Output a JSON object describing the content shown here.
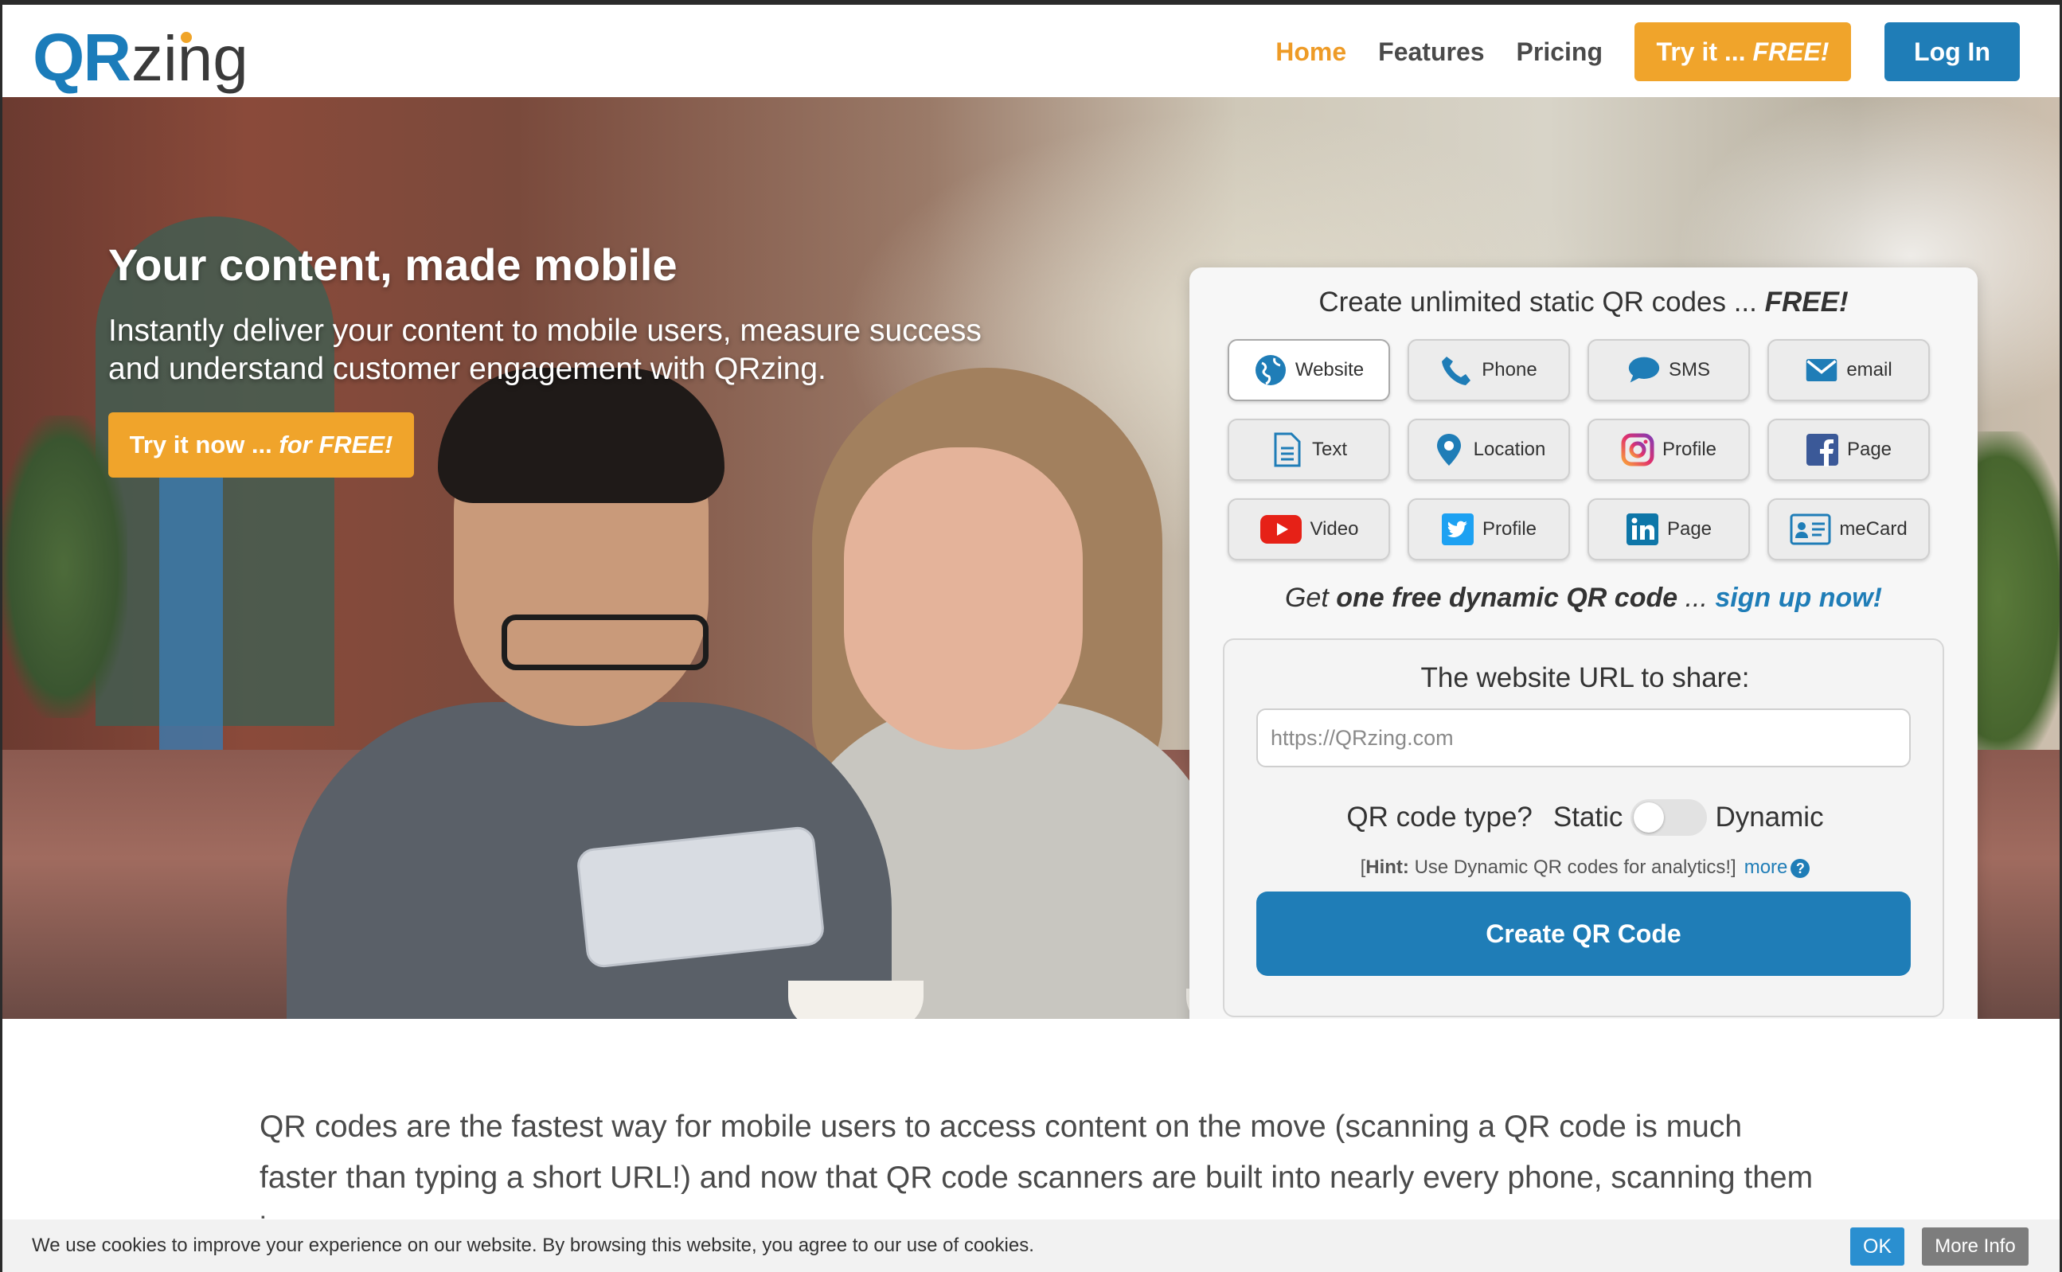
{
  "header": {
    "logo_qr": "QR",
    "logo_zing": "zing",
    "nav": [
      "Home",
      "Features",
      "Pricing"
    ],
    "try_free_prefix": "Try it ... ",
    "try_free_em": "FREE!",
    "login": "Log In"
  },
  "hero": {
    "title": "Your content, made mobile",
    "subtitle": "Instantly deliver your content to mobile users, measure success and understand customer engagement with QRzing.",
    "cta_prefix": "Try it now ... ",
    "cta_em": "for FREE!"
  },
  "panel": {
    "title_prefix": "Create unlimited static QR codes ... ",
    "title_em": "FREE!",
    "types": [
      {
        "label": "Website",
        "icon": "globe-icon",
        "selected": true
      },
      {
        "label": "Phone",
        "icon": "phone-icon"
      },
      {
        "label": "SMS",
        "icon": "chat-bubble-icon"
      },
      {
        "label": "email",
        "icon": "envelope-icon"
      },
      {
        "label": "Text",
        "icon": "document-icon"
      },
      {
        "label": "Location",
        "icon": "map-pin-icon"
      },
      {
        "label": "Profile",
        "icon": "instagram-icon"
      },
      {
        "label": "Page",
        "icon": "facebook-icon"
      },
      {
        "label": "Video",
        "icon": "youtube-icon"
      },
      {
        "label": "Profile",
        "icon": "twitter-icon"
      },
      {
        "label": "Page",
        "icon": "linkedin-icon"
      },
      {
        "label": "meCard",
        "icon": "contact-card-icon"
      }
    ],
    "dynamic_prefix": "Get ",
    "dynamic_bold": "one free dynamic QR code",
    "dynamic_mid": " ... ",
    "dynamic_link": "sign up now!",
    "form": {
      "label": "The website URL to share:",
      "placeholder": "https://QRzing.com",
      "type_label": "QR code type?",
      "static": "Static",
      "dynamic": "Dynamic",
      "hint_open": "[",
      "hint_bold": "Hint:",
      "hint_text": " Use Dynamic QR codes for analytics!]",
      "hint_more": "more",
      "hint_q": "?",
      "create": "Create QR Code"
    }
  },
  "intro": "QR codes are the fastest way for mobile users to access content on the move (scanning a QR code is much faster than typing a short URL!) and now that QR code scanners are built into nearly every phone, scanning them is",
  "cookie": {
    "text": "We use cookies to improve your experience on our website. By browsing this website, you agree to our use of cookies.",
    "ok": "OK",
    "more_info": "More Info"
  },
  "colors": {
    "brand_blue": "#1f7db7",
    "brand_orange": "#f0a42b",
    "nav_active": "#ee9b26"
  }
}
